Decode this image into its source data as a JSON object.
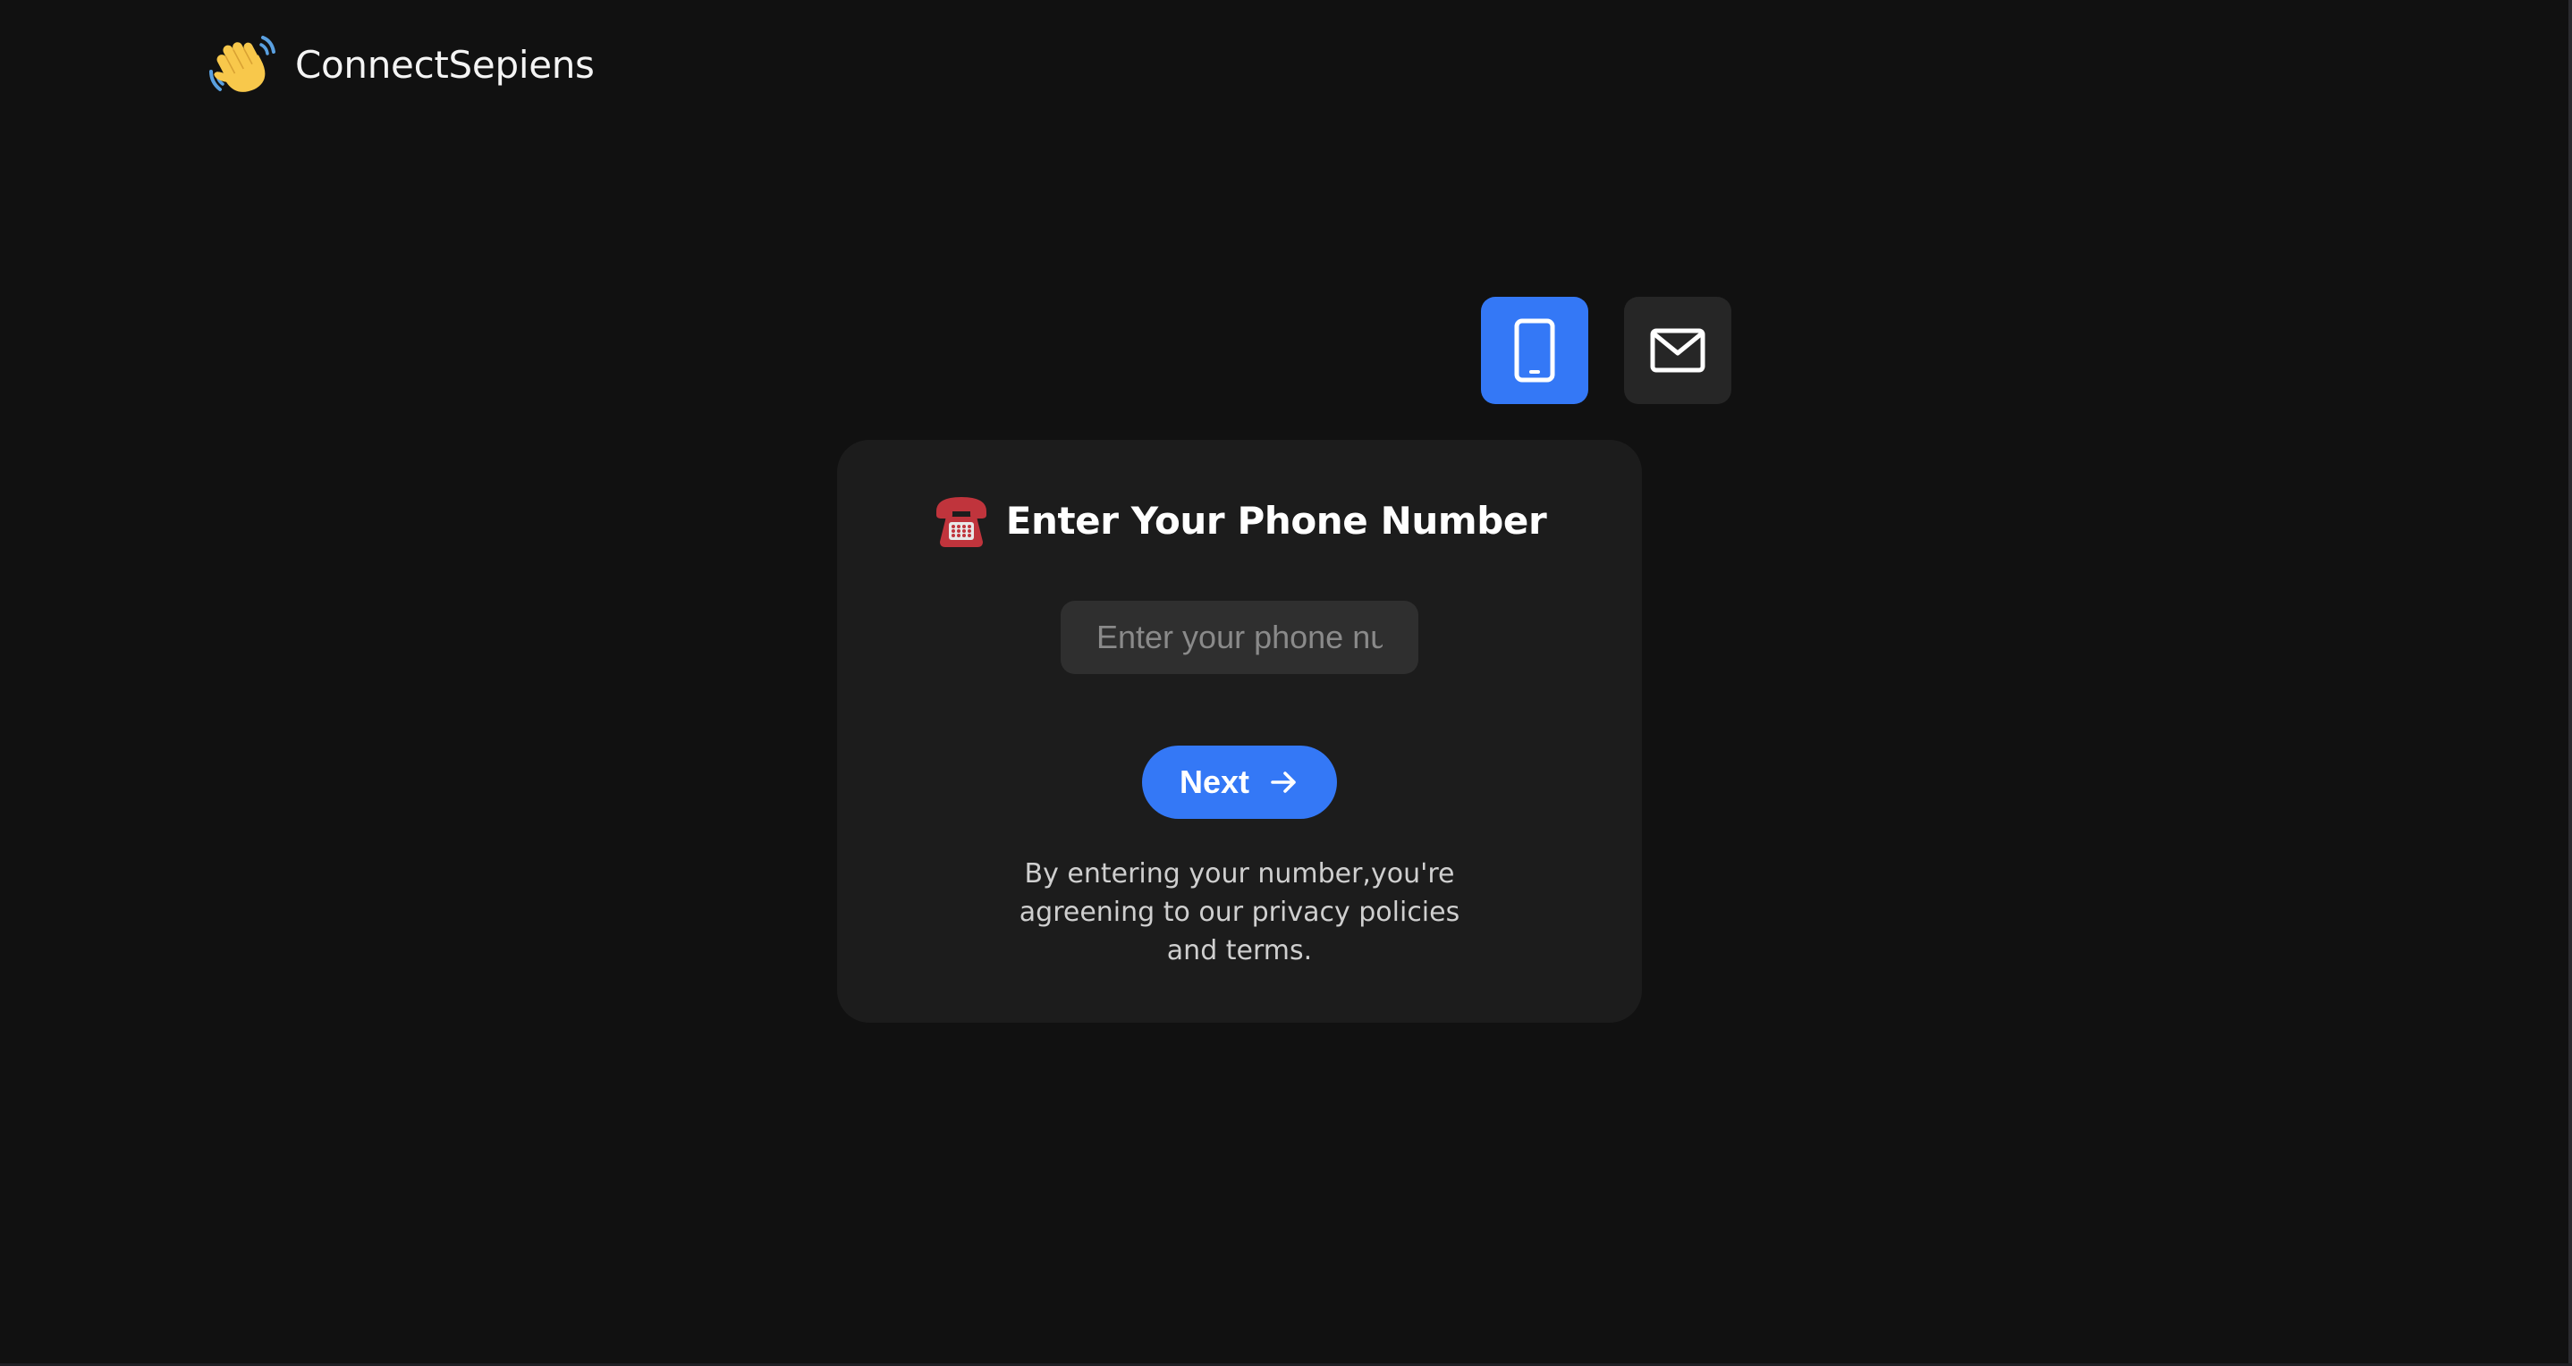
{
  "brand": {
    "name": "ConnectSepiens",
    "icon": "waving-hand-icon"
  },
  "mode_toggle": {
    "phone": {
      "icon": "mobile-phone-icon",
      "active": true,
      "color": "#3478f6"
    },
    "email": {
      "icon": "envelope-icon",
      "active": false,
      "color": "#262626"
    }
  },
  "card": {
    "title_icon": "telephone-icon",
    "title": "Enter Your Phone Number",
    "phone_input": {
      "value": "",
      "placeholder": "Enter your phone number"
    },
    "next_button": {
      "label": "Next",
      "icon": "arrow-right-icon"
    },
    "disclaimer": "By entering your number,you're agreening to our privacy policies and terms."
  },
  "colors": {
    "background": "#111111",
    "card": "#1c1c1c",
    "accent": "#3478f6",
    "input": "#2f2f2f"
  }
}
